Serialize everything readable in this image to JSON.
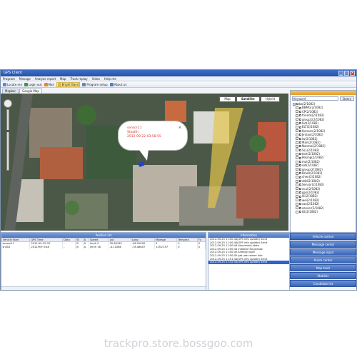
{
  "window": {
    "title": "GPS Client"
  },
  "menu": [
    "Program",
    "Manage",
    "Analyze report",
    "Map",
    "Track replay",
    "Video",
    "Help me"
  ],
  "toolbar": [
    {
      "label": "Locate me",
      "icon": "locate-icon",
      "color": "#5b8bd6"
    },
    {
      "label": "Login out",
      "icon": "logout-icon",
      "color": "#3a9b3a"
    },
    {
      "label": "Mail",
      "icon": "mail-icon",
      "color": "#e08a2a"
    },
    {
      "label": "Bright Band",
      "icon": "band-icon",
      "color": "#e2b73b",
      "active": true
    },
    {
      "label": "Program setup",
      "icon": "setup-icon",
      "color": "#6f83a6"
    },
    {
      "label": "About us",
      "icon": "about-icon",
      "color": "#4d7fd1"
    }
  ],
  "tabs": [
    "Mapbar",
    "Google Map"
  ],
  "map": {
    "types": [
      "Map",
      "Satellite",
      "Hybrid"
    ],
    "active_type": "Satellite",
    "popup": {
      "name": "sensor11",
      "status": "Stealth",
      "time": "2012-09-22 03:58:55",
      "close": "×"
    }
  },
  "right_panel": {
    "search_placeholder": "Keyword",
    "search_button": "Query",
    "tree": [
      {
        "label": "ba(2/1082)",
        "child": false
      },
      {
        "label": "BBMG(2/1082)",
        "child": true
      },
      {
        "label": "CP(2/1082)",
        "child": true
      },
      {
        "label": "friends(2/1082)",
        "child": true
      },
      {
        "label": "group1(2/1082)",
        "child": true
      },
      {
        "label": "kid(2/1082)",
        "child": true
      },
      {
        "label": "ELT(2/1082)",
        "child": true
      },
      {
        "label": "Henson(2/1082)",
        "child": true
      },
      {
        "label": "Jintiao(2/1082)",
        "child": true
      },
      {
        "label": "lw(2/1082)",
        "child": true
      },
      {
        "label": "Man(2/1082)",
        "child": true
      },
      {
        "label": "Nanmei(2/1082)",
        "child": true
      },
      {
        "label": "SLL(2/1082)",
        "child": true
      },
      {
        "label": "test(2/1082)",
        "child": true
      },
      {
        "label": "Peking(2/1082)",
        "child": true
      },
      {
        "label": "mal(2/1082)",
        "child": true
      },
      {
        "label": "old(2/1082)",
        "child": true
      },
      {
        "label": "group(2/1082)",
        "child": true
      },
      {
        "label": "Brazil(2/1082)",
        "child": true
      },
      {
        "label": "chen(2/1082)",
        "child": true
      },
      {
        "label": "ddd(2/1082)",
        "child": true
      },
      {
        "label": "Sensor(2/1082)",
        "child": true
      },
      {
        "label": "xcui(2/1082)",
        "child": true
      },
      {
        "label": "gps(2/1082)",
        "child": true
      },
      {
        "label": "lili(2/1082)",
        "child": true
      },
      {
        "label": "wei(2/1082)",
        "child": true
      },
      {
        "label": "ozx(2/1082)",
        "child": true
      },
      {
        "label": "sensor(2/1082)",
        "child": true
      },
      {
        "label": "ttt(2/1082)",
        "child": true
      }
    ]
  },
  "position_panel": {
    "title": "Position list",
    "columns": [
      "Vehicle Num",
      "GPS Time",
      "Data",
      "St",
      "A",
      "Speed",
      "Lat",
      "Long",
      "Mileage",
      "Tempera",
      "Fu"
    ],
    "rows": [
      [
        "sensor11",
        "2012-09-25 03",
        "-",
        "B",
        "A",
        "km/h 0",
        "35.69182",
        "-98.20090",
        "0",
        "0",
        "0"
      ],
      [
        "sn002",
        "2012/9/9 0:48",
        "-",
        "B",
        "A",
        "km/h 16",
        "-4.11086",
        "-78.48607",
        "12515.57",
        "0",
        "0"
      ]
    ]
  },
  "info_panel": {
    "title": "Information",
    "rows": [
      "2012-09-25 11:50:44(GPS info update) Send",
      "2012-09-25 11:50:44(GPS info update) Send",
      "2012-09-25 11:50:44 disconnect state",
      "2012-09-25 11:50:44 Initialize fail,please",
      "2012-09-25 11:50:45 Already login",
      "2012-09-25 11:50:45 get user alarm info",
      "2012-09-25 11:51:44(GPS info update) Send",
      "2012-09-25 11:52:44(GPS info update) Send"
    ],
    "selected_index": 7
  },
  "accordion": [
    "Vehicle control",
    "Message center",
    "Message input",
    "Alarm center",
    "Map tools",
    "Statistic",
    "Candidate list"
  ],
  "watermark": "trackpro.store.bossgoo.com",
  "colors": {
    "title_bar": "#2f5fb8",
    "panel_header": "#4a74c4",
    "selection": "#2f63c9",
    "accent_orange": "#e39b21"
  }
}
